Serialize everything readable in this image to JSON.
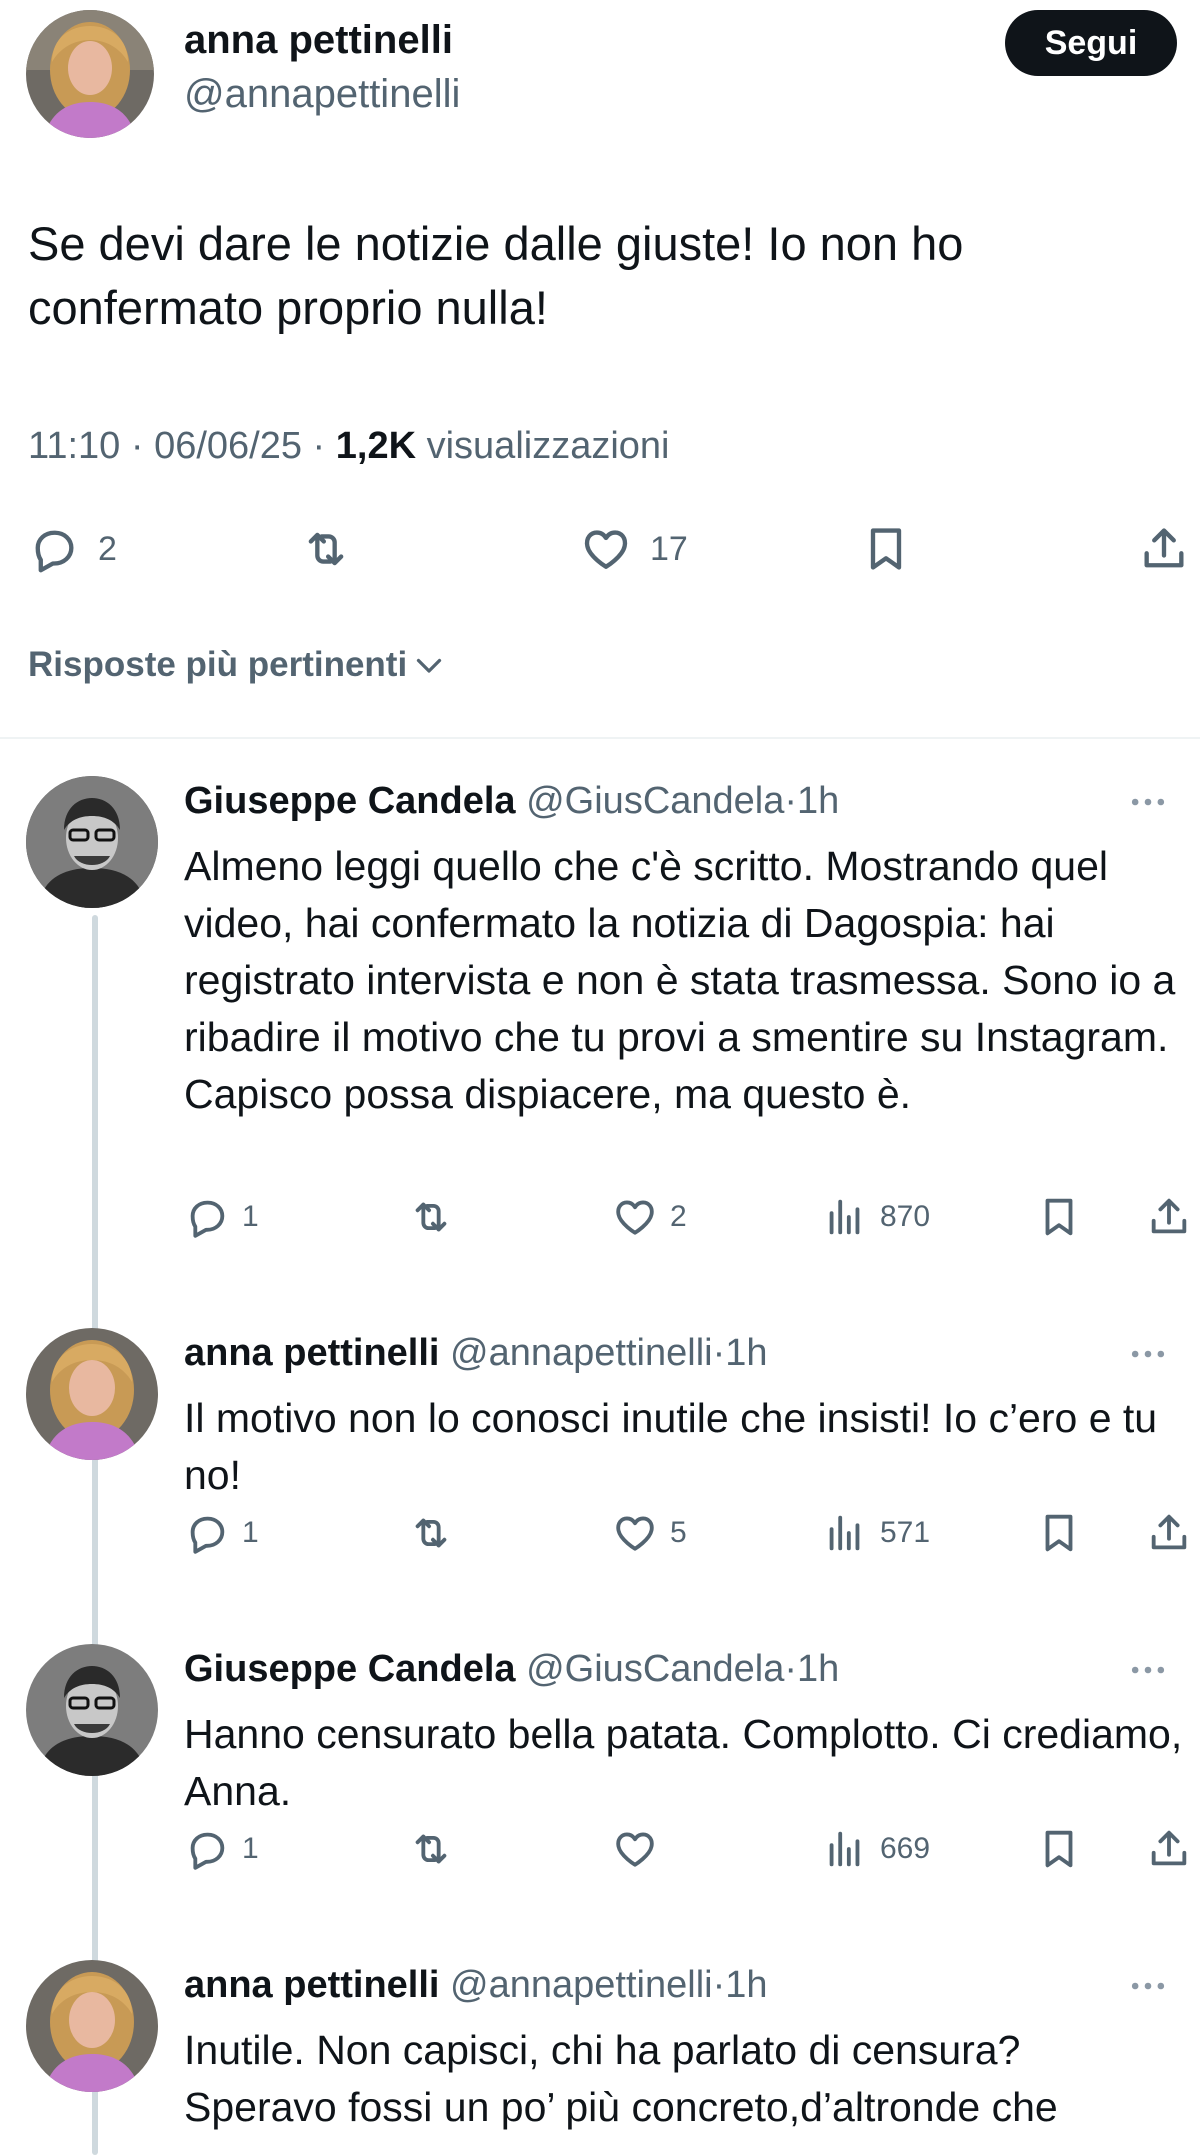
{
  "main_tweet": {
    "author_name": "anna pettinelli",
    "author_handle": "@annapettinelli",
    "follow_label": "Segui",
    "text": "Se devi dare le notizie dalle giuste! Io non ho confermato proprio nulla!",
    "time": "11:10",
    "date": "06/06/25",
    "separator": "·",
    "views_count": "1,2K",
    "views_label": "visualizzazioni",
    "replies": "2",
    "retweets": "",
    "likes": "17"
  },
  "sort": {
    "label": "Risposte più pertinenti"
  },
  "replies": [
    {
      "name": "Giuseppe Candela",
      "handle": "@GiusCandela",
      "sep": "·",
      "time": "1h",
      "text": "Almeno leggi quello che c'è scritto. Mostrando quel video, hai confermato la notizia di Dagospia: hai registrato intervista e non è stata trasmessa. Sono io a ribadire il motivo che tu provi a smentire su Instagram. Capisco possa dispiacere, ma questo è.",
      "replies": "1",
      "retweets": "",
      "likes": "2",
      "views": "870"
    },
    {
      "name": "anna pettinelli",
      "handle": "@annapettinelli",
      "sep": "·",
      "time": "1h",
      "text": "Il motivo non lo conosci inutile che insisti! Io c’ero e tu no!",
      "replies": "1",
      "retweets": "",
      "likes": "5",
      "views": "571"
    },
    {
      "name": "Giuseppe Candela",
      "handle": "@GiusCandela",
      "sep": "·",
      "time": "1h",
      "text": "Hanno censurato bella patata. Complotto. Ci crediamo, Anna.",
      "replies": "1",
      "retweets": "",
      "likes": "",
      "views": "669"
    },
    {
      "name": "anna pettinelli",
      "handle": "@annapettinelli",
      "sep": "·",
      "time": "1h",
      "text": "Inutile. Non capisci, chi ha parlato di censura? Speravo fossi un po’ più concreto,d’altronde che",
      "replies": "",
      "retweets": "",
      "likes": "",
      "views": ""
    }
  ],
  "icons": {
    "reply": "reply-bubble-icon",
    "retweet": "retweet-icon",
    "like": "heart-icon",
    "views": "views-bar-chart-icon",
    "bookmark": "bookmark-icon",
    "share": "share-icon",
    "more": "more-dots-icon",
    "sort": "chevron-down-icon"
  },
  "colors": {
    "text_primary": "#0f1419",
    "text_secondary": "#536471",
    "follow_button_bg": "#0f1419",
    "thread_line": "#cfd9de"
  }
}
